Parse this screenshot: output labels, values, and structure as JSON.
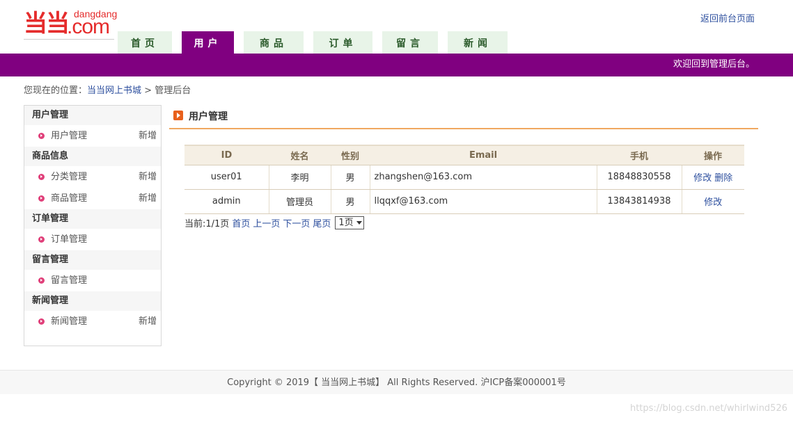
{
  "header": {
    "logo_text": "当当",
    "logo_sub": "dangdang",
    "logo_com": ".com",
    "back_link": "返回前台页面",
    "welcome": "欢迎回到管理后台。"
  },
  "nav": {
    "tabs": [
      {
        "label": "首页",
        "active": false
      },
      {
        "label": "用户",
        "active": true
      },
      {
        "label": "商品",
        "active": false
      },
      {
        "label": "订单",
        "active": false
      },
      {
        "label": "留言",
        "active": false
      },
      {
        "label": "新闻",
        "active": false
      }
    ]
  },
  "breadcrumb": {
    "prefix": "您现在的位置：",
    "link": "当当网上书城",
    "sep": " > ",
    "current": "管理后台"
  },
  "sidebar": {
    "groups": [
      {
        "title": "用户管理",
        "items": [
          {
            "label": "用户管理",
            "add": "新增"
          }
        ]
      },
      {
        "title": "商品信息",
        "items": [
          {
            "label": "分类管理",
            "add": "新增"
          },
          {
            "label": "商品管理",
            "add": "新增"
          }
        ]
      },
      {
        "title": "订单管理",
        "items": [
          {
            "label": "订单管理",
            "add": ""
          }
        ]
      },
      {
        "title": "留言管理",
        "items": [
          {
            "label": "留言管理",
            "add": ""
          }
        ]
      },
      {
        "title": "新闻管理",
        "items": [
          {
            "label": "新闻管理",
            "add": "新增"
          }
        ]
      }
    ]
  },
  "main": {
    "title": "用户管理",
    "table": {
      "headers": [
        "ID",
        "姓名",
        "性别",
        "Email",
        "手机",
        "操作"
      ],
      "rows": [
        {
          "id": "user01",
          "name": "李明",
          "gender": "男",
          "email": "zhangshen@163.com",
          "phone": "18848830558",
          "actions": [
            "修改",
            "删除"
          ]
        },
        {
          "id": "admin",
          "name": "管理员",
          "gender": "男",
          "email": "llqqxf@163.com",
          "phone": "13843814938",
          "actions": [
            "修改"
          ]
        }
      ]
    },
    "pager": {
      "current": "当前:1/1页",
      "first": "首页",
      "prev": "上一页",
      "next": "下一页",
      "last": "尾页",
      "select_value": "1页"
    }
  },
  "footer": {
    "text": "Copyright © 2019【 当当网上书城】 All Rights Reserved. 沪ICP备案000001号"
  },
  "watermark": "https://blog.csdn.net/whirlwind526",
  "colors": {
    "brand_purple": "#800080",
    "nav_tab_bg": "#e8f4e8",
    "logo_red": "#e52c2c",
    "link_blue": "#2d4f9e",
    "title_underline": "#f0a860"
  }
}
